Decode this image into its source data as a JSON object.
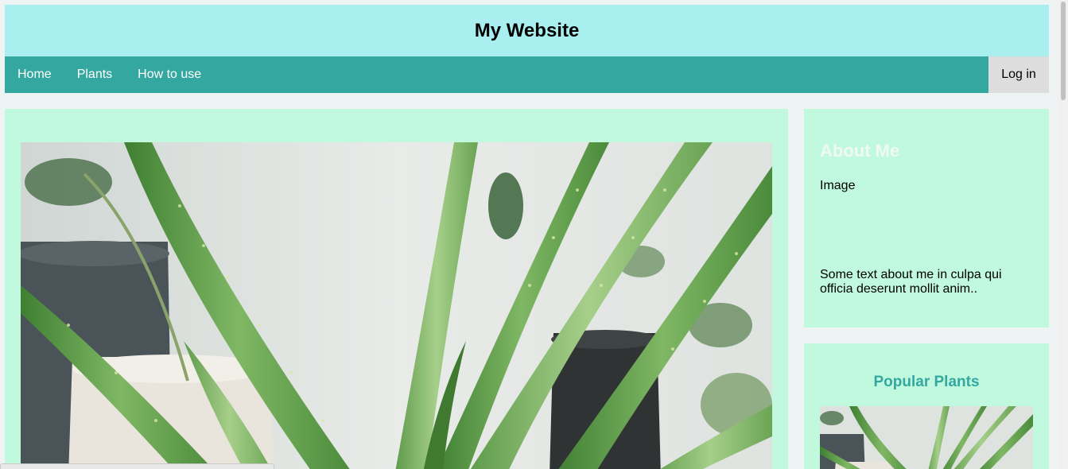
{
  "header": {
    "title": "My Website"
  },
  "nav": {
    "links": [
      "Home",
      "Plants",
      "How to use"
    ],
    "login_label": "Log in"
  },
  "sidebar": {
    "about": {
      "title": "About Me",
      "image_label": "Image",
      "text": "Some text about me in culpa qui officia deserunt mollit anim.."
    },
    "popular": {
      "title": "Popular Plants"
    }
  },
  "colors": {
    "header_bg": "#a9eff0",
    "nav_bg": "#34a8a0",
    "card_bg": "#c0f9de",
    "accent": "#34a8a0"
  },
  "icons": [
    "aloe-plant-photo"
  ]
}
